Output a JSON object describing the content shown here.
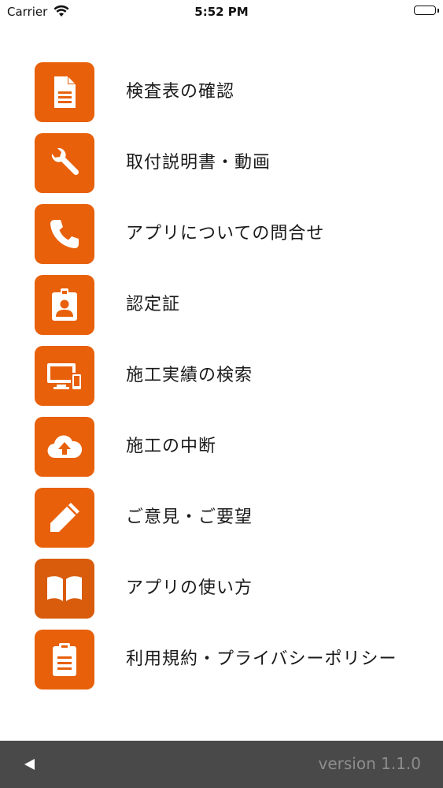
{
  "status_bar": {
    "carrier": "Carrier",
    "time": "5:52 PM",
    "battery_level": 1.0
  },
  "menu": {
    "accent_color": "#e8600a",
    "items": [
      {
        "label": "検査表の確認",
        "icon": "document-icon"
      },
      {
        "label": "取付説明書・動画",
        "icon": "wrench-icon"
      },
      {
        "label": "アプリについての問合せ",
        "icon": "phone-icon"
      },
      {
        "label": "認定証",
        "icon": "badge-icon"
      },
      {
        "label": "施工実績の検索",
        "icon": "devices-icon"
      },
      {
        "label": "施工の中断",
        "icon": "cloud-upload-icon"
      },
      {
        "label": "ご意見・ご要望",
        "icon": "pencil-icon"
      },
      {
        "label": "アプリの使い方",
        "icon": "book-icon"
      },
      {
        "label": "利用規約・プライバシーポリシー",
        "icon": "clipboard-icon"
      }
    ]
  },
  "footer": {
    "back_icon": "back-triangle-icon",
    "version": "version 1.1.0"
  }
}
